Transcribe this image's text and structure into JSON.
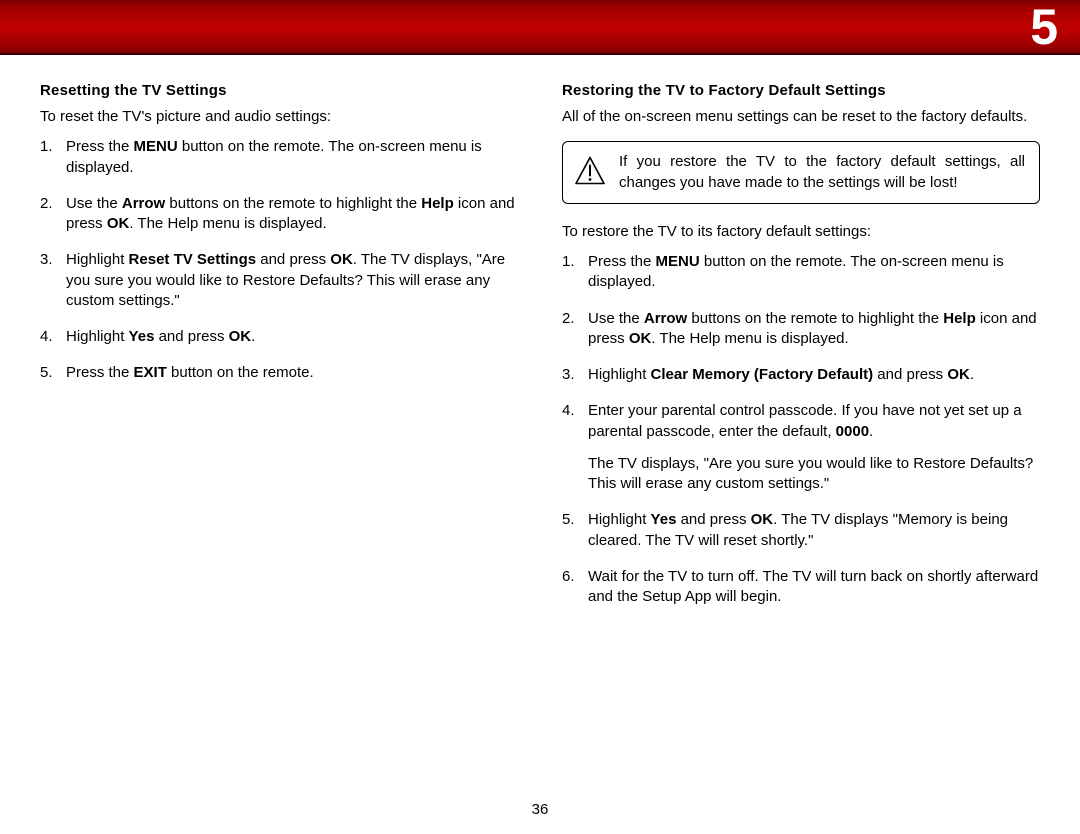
{
  "page_number_header": "5",
  "page_number_footer": "36",
  "left": {
    "heading": "Resetting the TV Settings",
    "intro": "To reset the TV's picture and audio settings:",
    "steps": [
      {
        "pre": "Press the ",
        "b1": "MENU",
        "post": " button on the remote. The on-screen menu is displayed."
      },
      {
        "pre": "Use the ",
        "b1": "Arrow",
        "mid": " buttons on the remote to highlight the ",
        "b2": "Help",
        "post2": " icon and press ",
        "b3": "OK",
        "post": ". The Help menu is displayed."
      },
      {
        "pre": "Highlight ",
        "b1": "Reset TV Settings",
        "mid": " and press ",
        "b2": "OK",
        "post": ". The TV displays, \"Are you sure you would like to Restore Defaults? This will erase any custom settings.\""
      },
      {
        "pre": "Highlight ",
        "b1": "Yes",
        "mid": " and press ",
        "b2": "OK",
        "post": "."
      },
      {
        "pre": "Press the ",
        "b1": "EXIT",
        "post": " button on the remote."
      }
    ]
  },
  "right": {
    "heading": "Restoring the TV to Factory Default Settings",
    "intro": "All of the on-screen menu settings can be reset to the factory defaults.",
    "warning": "If you restore the TV to the factory default settings, all changes you have made to the settings will be lost!",
    "intro2": "To restore the TV to its factory default settings:",
    "steps": [
      {
        "pre": "Press the ",
        "b1": "MENU",
        "post": " button on the remote. The on-screen menu is displayed."
      },
      {
        "pre": "Use the ",
        "b1": "Arrow",
        "mid": " buttons on the remote to highlight the ",
        "b2": "Help",
        "post2": " icon and press ",
        "b3": "OK",
        "post": ". The Help menu is displayed."
      },
      {
        "pre": "Highlight ",
        "b1": "Clear Memory (Factory Default)",
        "mid": " and press ",
        "b2": "OK",
        "post": "."
      },
      {
        "pre": "Enter your parental control passcode. If you have not yet set up a parental passcode, enter the default, ",
        "b1": "0000",
        "post": ".",
        "para": "The TV displays, \"Are you sure you would like to Restore Defaults? This will erase any custom settings.\""
      },
      {
        "pre": "Highlight ",
        "b1": "Yes",
        "mid": " and press ",
        "b2": "OK",
        "post": ". The TV displays \"Memory is being cleared. The TV will reset shortly.\""
      },
      {
        "pre": "Wait for the TV to turn off. The TV will turn back on shortly afterward and the Setup App will begin."
      }
    ]
  }
}
